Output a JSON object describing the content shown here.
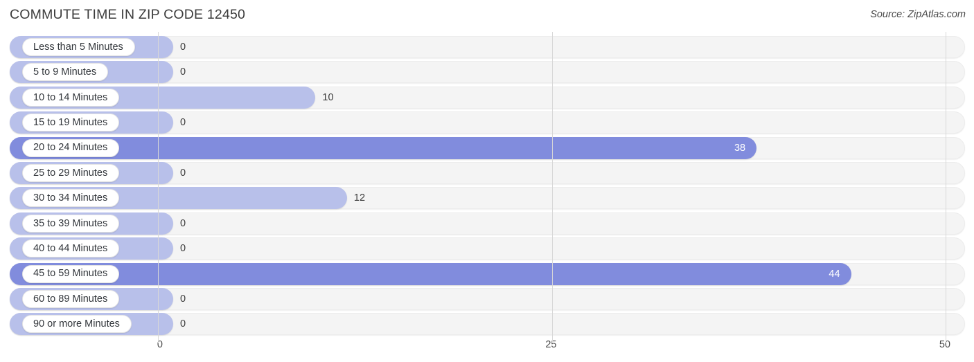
{
  "header": {
    "title": "COMMUTE TIME IN ZIP CODE 12450",
    "source": "Source: ZipAtlas.com"
  },
  "colors": {
    "bar_low": "#b8c0ea",
    "bar_high": "#818cdd",
    "track": "#f4f4f4",
    "gridline": "#d7d7d7",
    "title_text": "#3c3c3c",
    "label_text": "#33373c",
    "value_text_outside": "#3a3a3a",
    "value_text_inside": "#ffffff"
  },
  "chart_data": {
    "type": "bar",
    "orientation": "horizontal",
    "title": "COMMUTE TIME IN ZIP CODE 12450",
    "xlabel": "",
    "ylabel": "",
    "xlim": [
      0,
      50
    ],
    "xticks": [
      0,
      25,
      50
    ],
    "xtick_labels": [
      "0",
      "25",
      "50"
    ],
    "grid": true,
    "legend": false,
    "categories": [
      "Less than 5 Minutes",
      "5 to 9 Minutes",
      "10 to 14 Minutes",
      "15 to 19 Minutes",
      "20 to 24 Minutes",
      "25 to 29 Minutes",
      "30 to 34 Minutes",
      "35 to 39 Minutes",
      "40 to 44 Minutes",
      "45 to 59 Minutes",
      "60 to 89 Minutes",
      "90 or more Minutes"
    ],
    "values": [
      0,
      0,
      10,
      0,
      38,
      0,
      12,
      0,
      0,
      44,
      0,
      0
    ],
    "value_labels": [
      "0",
      "0",
      "10",
      "0",
      "38",
      "0",
      "12",
      "0",
      "0",
      "44",
      "0",
      "0"
    ]
  },
  "rows": [
    {
      "label": "Less than 5 Minutes",
      "value": 0,
      "value_label": "0",
      "tone": "low"
    },
    {
      "label": "5 to 9 Minutes",
      "value": 0,
      "value_label": "0",
      "tone": "low"
    },
    {
      "label": "10 to 14 Minutes",
      "value": 10,
      "value_label": "10",
      "tone": "low"
    },
    {
      "label": "15 to 19 Minutes",
      "value": 0,
      "value_label": "0",
      "tone": "low"
    },
    {
      "label": "20 to 24 Minutes",
      "value": 38,
      "value_label": "38",
      "tone": "high"
    },
    {
      "label": "25 to 29 Minutes",
      "value": 0,
      "value_label": "0",
      "tone": "low"
    },
    {
      "label": "30 to 34 Minutes",
      "value": 12,
      "value_label": "12",
      "tone": "low"
    },
    {
      "label": "35 to 39 Minutes",
      "value": 0,
      "value_label": "0",
      "tone": "low"
    },
    {
      "label": "40 to 44 Minutes",
      "value": 0,
      "value_label": "0",
      "tone": "low"
    },
    {
      "label": "45 to 59 Minutes",
      "value": 44,
      "value_label": "44",
      "tone": "high"
    },
    {
      "label": "60 to 89 Minutes",
      "value": 0,
      "value_label": "0",
      "tone": "low"
    },
    {
      "label": "90 or more Minutes",
      "value": 0,
      "value_label": "0",
      "tone": "low"
    }
  ],
  "axis": {
    "ticks": [
      {
        "label": "0",
        "value": 0
      },
      {
        "label": "25",
        "value": 25
      },
      {
        "label": "50",
        "value": 50
      }
    ]
  }
}
